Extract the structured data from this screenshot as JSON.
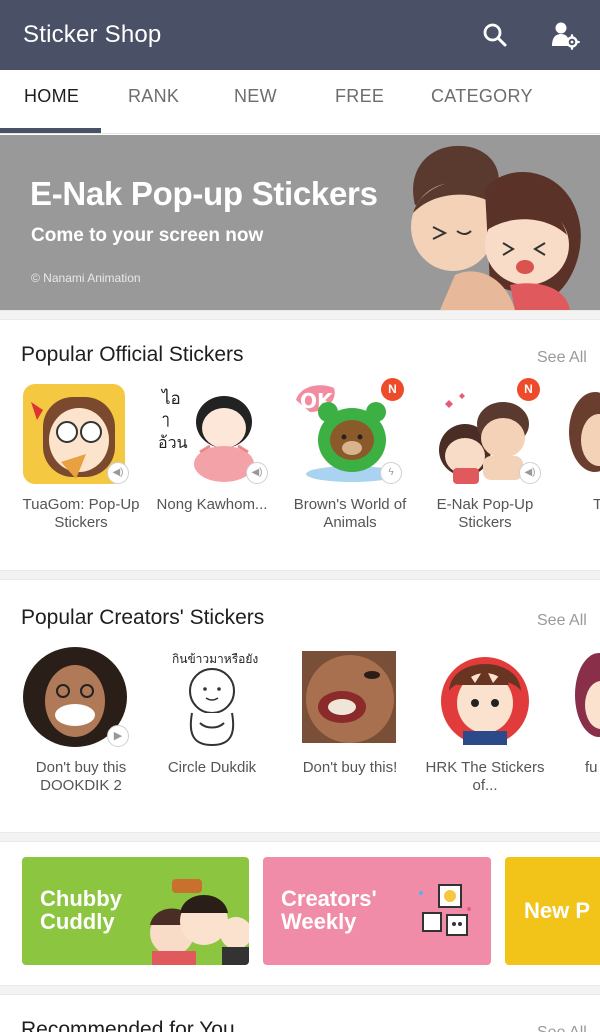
{
  "header": {
    "title": "Sticker Shop",
    "search_icon": "search-icon",
    "settings_icon": "user-settings-icon"
  },
  "tabs": [
    {
      "label": "HOME",
      "active": true
    },
    {
      "label": "RANK",
      "active": false
    },
    {
      "label": "NEW",
      "active": false
    },
    {
      "label": "FREE",
      "active": false
    },
    {
      "label": "CATEGORY",
      "active": false
    }
  ],
  "banner": {
    "title": "E-Nak Pop-up Stickers",
    "subtitle": "Come to your screen now",
    "credit": "© Nanami Animation"
  },
  "official": {
    "title": "Popular Official Stickers",
    "see_all": "See All",
    "items": [
      {
        "caption": "TuaGom: Pop-Up Stickers",
        "badge": "",
        "sound": true
      },
      {
        "caption": "Nong Kawhom...",
        "badge": "",
        "sound": true
      },
      {
        "caption": "Brown's World of Animals",
        "badge": "N",
        "sound": true
      },
      {
        "caption": "E-Nak Pop-Up Stickers",
        "badge": "N",
        "sound": true
      },
      {
        "caption": "T",
        "badge": "",
        "sound": false
      }
    ]
  },
  "creators": {
    "title": "Popular Creators' Stickers",
    "see_all": "See All",
    "items": [
      {
        "caption": "Don't buy this DOOKDIK 2",
        "play": true
      },
      {
        "caption": "Circle Dukdik",
        "play": false
      },
      {
        "caption": "Don't buy this!",
        "play": false
      },
      {
        "caption": "HRK The Stickers of...",
        "play": false
      },
      {
        "caption": "fu C",
        "play": false
      }
    ],
    "sticker_text": "กินข้าวมาหรือยัง"
  },
  "promos": [
    {
      "label": "Chubby\nCuddly",
      "color": "#8cc540"
    },
    {
      "label": "Creators'\nWeekly",
      "color": "#f08ba8"
    },
    {
      "label": "New P",
      "color": "#f2c318"
    }
  ],
  "recommended": {
    "title": "Recommended for You",
    "see_all": "See All"
  },
  "colors": {
    "appbar": "#4a5167",
    "banner": "#999999",
    "badge": "#ee4b2b"
  }
}
